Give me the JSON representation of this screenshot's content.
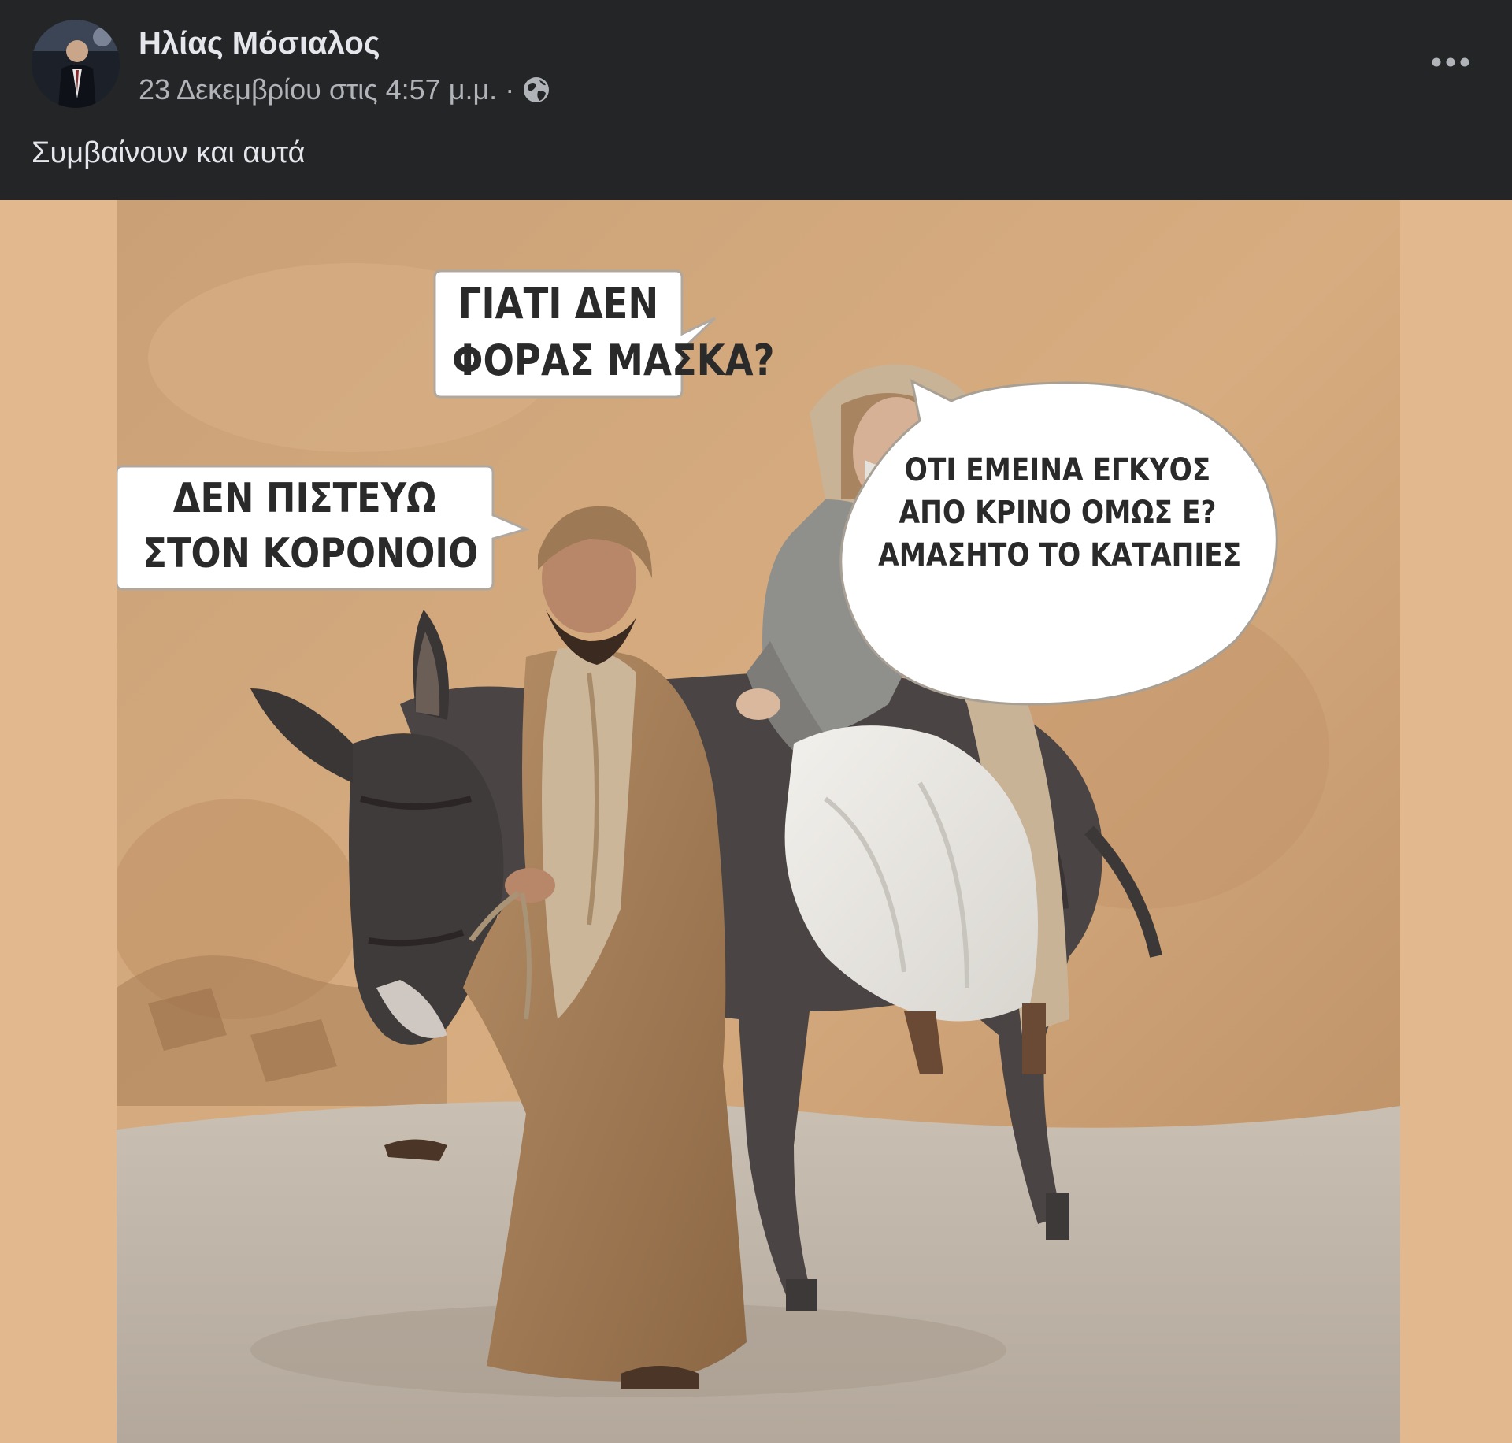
{
  "post": {
    "author_name": "Ηλίας Μόσιαλος",
    "timestamp": "23 Δεκεμβρίου στις 4:57 μ.μ.",
    "separator": "·",
    "audience_icon": "globe-icon",
    "more_icon": "more-options-icon",
    "text": "Συμβαίνουν και αυτά"
  },
  "meme": {
    "bubble_left": [
      "ΔΕΝ ΠΙΣΤΕΥΩ",
      "ΣΤΟΝ ΚΟΡΟΝΟΙΟ"
    ],
    "bubble_top": [
      "ΓΙΑΤΙ ΔΕΝ",
      "ΦΟΡΑΣ ΜΑΣΚΑ?"
    ],
    "bubble_right": [
      "ΟΤΙ ΕΜΕΙΝΑ ΕΓΚΥΟΣ",
      "ΑΠΟ ΚΡΙΝΟ ΟΜΩΣ Ε?",
      "ΑΜΑΣΗΤΟ ΤΟ ΚΑΤΑΠΙΕΣ"
    ]
  },
  "colors": {
    "header_bg": "#242526",
    "primary_text": "#e4e6eb",
    "secondary_text": "#b0b3b8",
    "media_bg": "#e2b88e"
  }
}
